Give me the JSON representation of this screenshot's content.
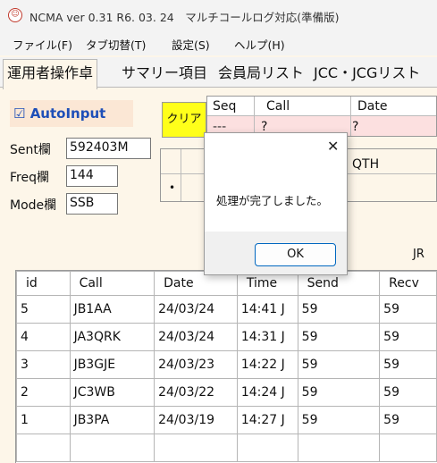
{
  "window": {
    "title": "NCMA ver 0.31  R6. 03. 24　マルチコールログ対応(準備版)",
    "app_icon_glyph": "☺"
  },
  "menu": [
    "ファイル(F)",
    "タブ切替(T)",
    "設定(S)",
    "ヘルプ(H)"
  ],
  "tabs": [
    {
      "label": "運用者操作卓",
      "active": true
    },
    {
      "label": "サマリー項目",
      "active": false
    },
    {
      "label": "会員局リスト",
      "active": false
    },
    {
      "label": "JCC・JCGリスト",
      "active": false
    }
  ],
  "left_panel": {
    "autoinput": {
      "checked": true,
      "label": "AutoInput",
      "check_glyph": "☑"
    },
    "sent": {
      "label": "Sent欄",
      "value": "592403M"
    },
    "freq": {
      "label": "Freq欄",
      "value": "144"
    },
    "mode": {
      "label": "Mode欄",
      "value": "SSB"
    }
  },
  "qso_grid": {
    "clear_label": "クリア",
    "headers": {
      "seq": "Seq",
      "call": "Call",
      "date": "Date"
    },
    "row1": {
      "seq": "---",
      "call": "?",
      "date": "?"
    },
    "qth_header": "QTH",
    "indicator": "•"
  },
  "right_label": "JR",
  "log_table": {
    "columns": [
      "id",
      "Call",
      "Date",
      "Time",
      "Send",
      "Recv"
    ],
    "rows": [
      [
        "5",
        "JB1AA",
        "24/03/24",
        "14:41 J",
        "59",
        "59"
      ],
      [
        "4",
        "JA3QRK",
        "24/03/24",
        "14:31 J",
        "59",
        "59"
      ],
      [
        "3",
        "JB3GJE",
        "24/03/23",
        "14:22 J",
        "59",
        "59"
      ],
      [
        "2",
        "JC3WB",
        "24/03/22",
        "14:24 J",
        "59",
        "59"
      ],
      [
        "1",
        "JB3PA",
        "24/03/19",
        "14:27 J",
        "59",
        "59"
      ]
    ]
  },
  "dialog": {
    "close_glyph": "✕",
    "message": "処理が完了しました。",
    "ok_label": "OK"
  }
}
